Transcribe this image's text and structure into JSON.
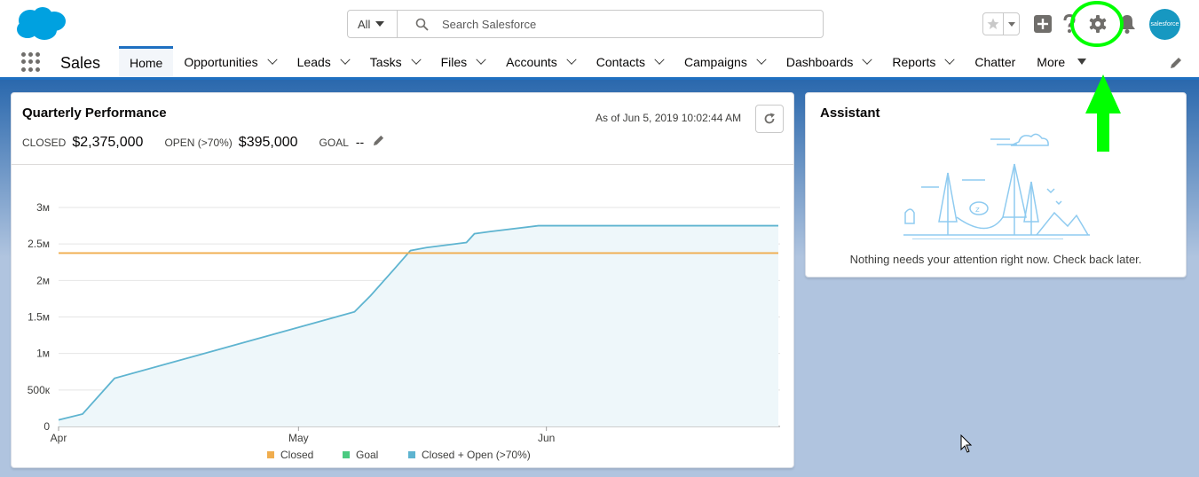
{
  "header": {
    "search_scope": "All",
    "search_placeholder": "Search Salesforce",
    "icons": [
      "salesforce-logo",
      "search-icon",
      "favorites-star-icon",
      "global-add-icon",
      "help-icon",
      "setup-gear-icon",
      "notifications-bell-icon",
      "user-avatar"
    ],
    "avatar_text": "salesforce"
  },
  "nav": {
    "app_name": "Sales",
    "tabs": [
      {
        "label": "Home"
      },
      {
        "label": "Opportunities"
      },
      {
        "label": "Leads"
      },
      {
        "label": "Tasks"
      },
      {
        "label": "Files"
      },
      {
        "label": "Accounts"
      },
      {
        "label": "Contacts"
      },
      {
        "label": "Campaigns"
      },
      {
        "label": "Dashboards"
      },
      {
        "label": "Reports"
      },
      {
        "label": "Chatter"
      },
      {
        "label": "More"
      }
    ],
    "active_tab": "Home"
  },
  "performance": {
    "title": "Quarterly Performance",
    "as_of": "As of Jun 5, 2019 10:02:44 AM",
    "closed_label": "CLOSED",
    "closed_value": "$2,375,000",
    "open_label": "OPEN (>70%)",
    "open_value": "$395,000",
    "goal_label": "GOAL",
    "goal_value": "--"
  },
  "chart_data": {
    "type": "area",
    "title": "",
    "x_ticks": [
      "Apr",
      "May",
      "Jun"
    ],
    "y_ticks": [
      "0",
      "500к",
      "1м",
      "1.5м",
      "2м",
      "2.5м",
      "3м"
    ],
    "ylim": [
      0,
      3000000
    ],
    "xlim": [
      "Apr 1",
      "Jun 30"
    ],
    "grid": true,
    "legend_position": "bottom",
    "legend": [
      {
        "name": "Closed",
        "color": "#f0ad4e"
      },
      {
        "name": "Goal",
        "color": "#4bca81"
      },
      {
        "name": "Closed + Open (>70%)",
        "color": "#5eb4d0"
      }
    ],
    "series": [
      {
        "name": "Closed",
        "type": "line",
        "color": "#f0ad4e",
        "x": [
          1,
          91
        ],
        "values": [
          2375000,
          2375000
        ]
      },
      {
        "name": "Closed + Open (>70%)",
        "type": "area",
        "color": "#5eb4d0",
        "x": [
          1,
          4,
          8,
          38,
          40,
          43,
          45,
          47,
          52,
          53,
          55,
          61,
          91
        ],
        "values": [
          90000,
          170000,
          660000,
          1570000,
          1790000,
          2160000,
          2410000,
          2450000,
          2520000,
          2640000,
          2670000,
          2750000,
          2750000
        ]
      }
    ]
  },
  "assistant": {
    "title": "Assistant",
    "message": "Nothing needs your attention right now. Check back later."
  },
  "annotation": {
    "color": "#00ff00",
    "target": "setup-gear-icon"
  }
}
